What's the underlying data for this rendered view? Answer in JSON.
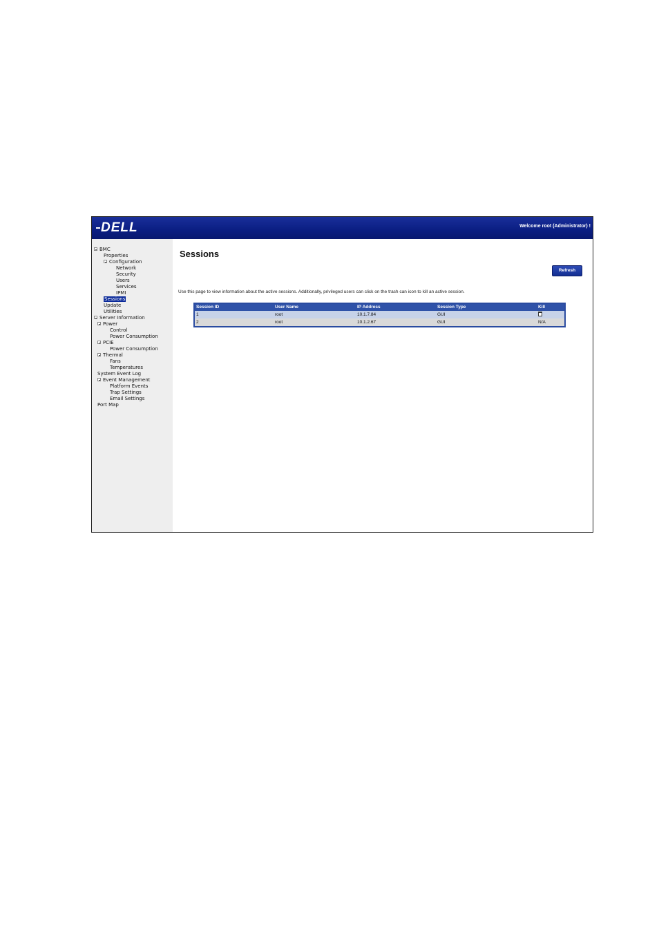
{
  "header": {
    "logo": "DELL",
    "welcome": "Welcome root (Administrator) !"
  },
  "sidebar": {
    "items": [
      {
        "label": "BMC",
        "toggle": true
      },
      {
        "label": "Properties"
      },
      {
        "label": "Configuration",
        "toggle": true
      },
      {
        "label": "Network"
      },
      {
        "label": "Security"
      },
      {
        "label": "Users"
      },
      {
        "label": "Services"
      },
      {
        "label": "IPMI"
      },
      {
        "label": "Sessions",
        "selected": true
      },
      {
        "label": "Update"
      },
      {
        "label": "Utilities"
      },
      {
        "label": "Server Information",
        "toggle": true
      },
      {
        "label": "Power",
        "toggle": true
      },
      {
        "label": "Control"
      },
      {
        "label": "Power Consumption"
      },
      {
        "label": "PCIE",
        "toggle": true
      },
      {
        "label": "Power Consumption"
      },
      {
        "label": "Thermal",
        "toggle": true
      },
      {
        "label": "Fans"
      },
      {
        "label": "Temperatures"
      },
      {
        "label": "System Event Log"
      },
      {
        "label": "Event Management",
        "toggle": true
      },
      {
        "label": "Platform Events"
      },
      {
        "label": "Trap Settings"
      },
      {
        "label": "Email Settings"
      },
      {
        "label": "Port Map"
      }
    ]
  },
  "main": {
    "title": "Sessions",
    "refresh_label": "Refresh",
    "description": "Use this page to view information about the active sessions. Additionally, privileged users can click on the trash can icon to kill an active session.",
    "table": {
      "columns": [
        "Session ID",
        "User Name",
        "IP Address",
        "Session Type",
        "Kill"
      ],
      "rows": [
        {
          "id": "1",
          "user": "root",
          "ip": "10.1.7.84",
          "type": "GUI",
          "kill": "trash-icon"
        },
        {
          "id": "2",
          "user": "root",
          "ip": "10.1.2.67",
          "type": "GUI",
          "kill": "N/A"
        }
      ]
    }
  },
  "colors": {
    "header": "#0b1f84",
    "selected": "#0b2a9a",
    "table_header": "#2f52a8",
    "row_odd": "#c7d2e8",
    "row_even": "#d9d9d9",
    "sidebar_bg": "#eeeeee"
  }
}
